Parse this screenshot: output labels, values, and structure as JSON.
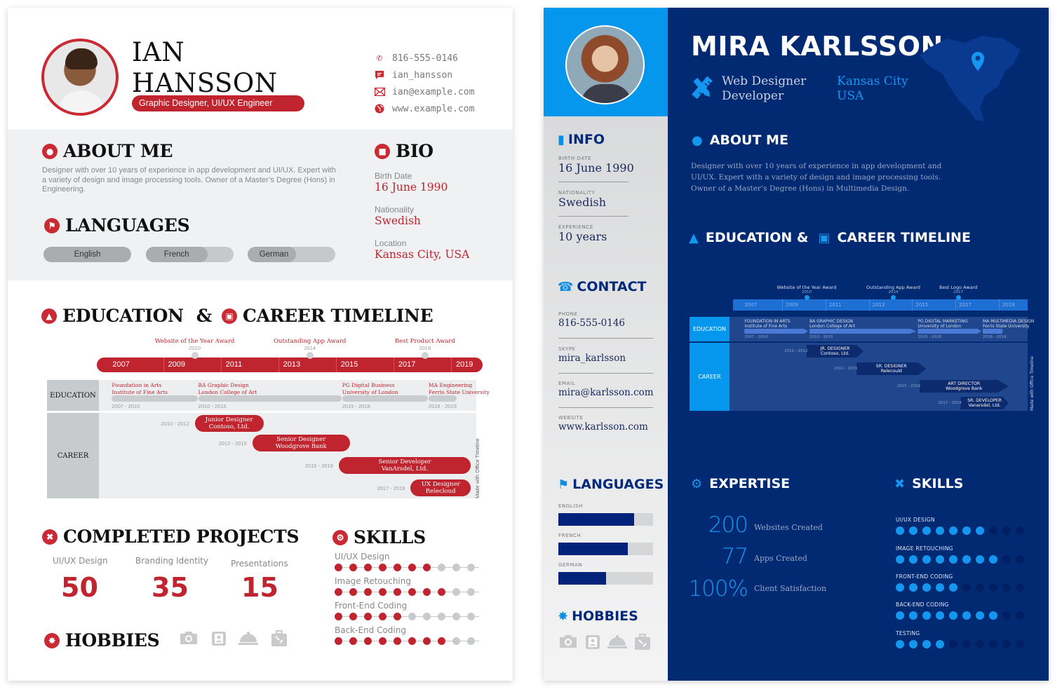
{
  "ian": {
    "name_line1": "IAN",
    "name_line2": "HANSSON",
    "title": "Graphic Designer, UI/UX Engineer",
    "contacts": [
      {
        "icon": "phone-icon",
        "value": "816-555-0146"
      },
      {
        "icon": "chat-icon",
        "value": "ian_hansson"
      },
      {
        "icon": "mail-icon",
        "value": "ian@example.com"
      },
      {
        "icon": "globe-icon",
        "value": "www.example.com"
      }
    ],
    "about": {
      "heading": "ABOUT ME",
      "text": "Designer with over 10 years of experience in app development and UI/UX. Expert with a variety of design and image processing tools. Owner of a Master’s Degree (Hons) in Engineering."
    },
    "languages": {
      "heading": "LANGUAGES",
      "items": [
        {
          "label": "English",
          "level": 1.0
        },
        {
          "label": "French",
          "level": 0.7
        },
        {
          "label": "German",
          "level": 0.55
        }
      ]
    },
    "bio": {
      "heading": "BIO",
      "items": [
        {
          "label": "Birth Date",
          "value": "16 June 1990"
        },
        {
          "label": "Nationality",
          "value": "Swedish"
        },
        {
          "label": "Location",
          "value": "Kansas City, USA"
        }
      ]
    },
    "timeline": {
      "heading_left": "EDUCATION",
      "amp": "&",
      "heading_right": "CAREER TIMELINE",
      "years": [
        "2007",
        "2009",
        "2011",
        "2013",
        "2015",
        "2017",
        "2019"
      ],
      "awards": [
        {
          "label": "Website of the Year Award",
          "year": "2010"
        },
        {
          "label": "Outstanding App Award",
          "year": "2014"
        },
        {
          "label": "Best Product Award",
          "year": "2018"
        }
      ],
      "education_label": "EDUCATION",
      "education": [
        {
          "title": "Foundation in Arts",
          "school": "Institute of Fine Arts",
          "years": "2007 - 2010"
        },
        {
          "title": "BA Graphic Design",
          "school": "London College of Art",
          "years": "2010 - 2015"
        },
        {
          "title": "PG Digital Business",
          "school": "University of London",
          "years": "2015 - 2018"
        },
        {
          "title": "MA Engineering",
          "school": "Ferris State University",
          "years": "2018 - 2019"
        }
      ],
      "career_label": "CAREER",
      "career": [
        {
          "title": "Junior Designer",
          "company": "Contoso, Ltd.",
          "years": "2010 - 2012"
        },
        {
          "title": "Senior Designer",
          "company": "Woodgrove Bank",
          "years": "2012 - 2015"
        },
        {
          "title": "Senior Developer",
          "company": "VanArsdel, Ltd.",
          "years": "2015 - 2019"
        },
        {
          "title": "UX Designer",
          "company": "Relecloud",
          "years": "2017 - 2019"
        }
      ],
      "made_with": "Made with  Office Timeline"
    },
    "projects": {
      "heading": "COMPLETED PROJECTS",
      "items": [
        {
          "label": "UI/UX Design",
          "value": "50"
        },
        {
          "label": "Branding Identity",
          "value": "35"
        },
        {
          "label": "Presentations",
          "value": "15"
        }
      ]
    },
    "hobbies": {
      "heading": "HOBBIES",
      "icons": [
        "camera-icon",
        "portrait-icon",
        "cloche-icon",
        "luggage-icon"
      ]
    },
    "skills": {
      "heading": "SKILLS",
      "max": 10,
      "items": [
        {
          "label": "UI/UX Design",
          "level": 7
        },
        {
          "label": "Image Retouching",
          "level": 8
        },
        {
          "label": "Front-End Coding",
          "level": 5
        },
        {
          "label": "Back-End Coding",
          "level": 8
        }
      ]
    },
    "colors": {
      "accent": "#c0242e",
      "muted": "#c8cbce"
    }
  },
  "mira": {
    "name": "MIRA KARLSSON",
    "role_line1": "Web Designer",
    "role_line2": "Developer",
    "location_line1": "Kansas City",
    "location_line2": "USA",
    "info": {
      "heading": "INFO",
      "items": [
        {
          "label": "BIRTH DATE",
          "value": "16 June 1990"
        },
        {
          "label": "NATIONALITY",
          "value": "Swedish"
        },
        {
          "label": "EXPERIENCE",
          "value": "10 years"
        }
      ]
    },
    "contact": {
      "heading": "CONTACT",
      "items": [
        {
          "label": "PHONE",
          "value": "816-555-0146"
        },
        {
          "label": "SKYPE",
          "value": "mira_karlsson"
        },
        {
          "label": "EMAIL",
          "value": "mira@karlsson.com"
        },
        {
          "label": "WEBSITE",
          "value": "www.karlsson.com"
        }
      ]
    },
    "languages": {
      "heading": "LANGUAGES",
      "items": [
        {
          "label": "ENGLISH",
          "level": 0.8
        },
        {
          "label": "FRENCH",
          "level": 0.73
        },
        {
          "label": "GERMAN",
          "level": 0.5
        }
      ]
    },
    "hobbies": {
      "heading": "HOBBIES",
      "icons": [
        "camera-icon",
        "portrait-icon",
        "cloche-icon",
        "luggage-icon"
      ]
    },
    "about": {
      "heading": "ABOUT ME",
      "text": "Designer with over 10 years of experience in app development and UI/UX. Expert with a variety of design and image processing tools. Owner of a Master’s Degree (Hons) in Multimedia Design."
    },
    "timeline": {
      "heading_left": "EDUCATION &",
      "heading_right": "CAREER TIMELINE",
      "years": [
        "2007",
        "2009",
        "2011",
        "2013",
        "2015",
        "2017",
        "2019"
      ],
      "awards": [
        {
          "label": "Website of the Year Award",
          "year": "2010"
        },
        {
          "label": "Outstanding App Award",
          "year": "2014"
        },
        {
          "label": "Best Logo Award",
          "year": "2017"
        }
      ],
      "education_label": "EDUCATION",
      "education": [
        {
          "title": "FOUNDATION IN ARTS",
          "school": "Institute of Fine Arts",
          "years": "2007 - 2010"
        },
        {
          "title": "BA GRAPHIC DESIGN",
          "school": "London College of Art",
          "years": "2010 - 2015"
        },
        {
          "title": "PG DIGITAL MARKETING",
          "school": "University of London",
          "years": "2015 - 2018"
        },
        {
          "title": "MA MULTIMEDIA DESIGN",
          "school": "Ferris State University",
          "years": "2018 - 2019"
        }
      ],
      "career_label": "CAREER",
      "career": [
        {
          "title": "JR. DESIGNER",
          "company": "Contoso, Ltd.",
          "years": "2010 - 2012"
        },
        {
          "title": "SR. DESIGNER",
          "company": "Relecould",
          "years": "2012 - 2015"
        },
        {
          "title": "ART DIRECTOR",
          "company": "Woodgrove Bank",
          "years": "2015 - 2019"
        },
        {
          "title": "SR. DEVELOPER",
          "company": "Vanarsdel, Ltd.",
          "years": "2017 - 2019"
        }
      ],
      "made_with": "Made with  Office Timeline"
    },
    "expertise": {
      "heading": "EXPERTISE",
      "items": [
        {
          "value": "200",
          "label": "Websites Created"
        },
        {
          "value": "77",
          "label": "Apps Created"
        },
        {
          "value": "100%",
          "label": "Client Satisfaction"
        }
      ]
    },
    "skills": {
      "heading": "SKILLS",
      "max": 10,
      "items": [
        {
          "label": "UI/UX DESIGN",
          "level": 7
        },
        {
          "label": "IMAGE RETOUCHING",
          "level": 8
        },
        {
          "label": "FRONT-END  CODING",
          "level": 5
        },
        {
          "label": "BACK-END CODING",
          "level": 8
        },
        {
          "label": "TESTING",
          "level": 4
        }
      ]
    },
    "colors": {
      "primary": "#012a73",
      "accent": "#1596ef",
      "panel": "#0596ee"
    }
  }
}
